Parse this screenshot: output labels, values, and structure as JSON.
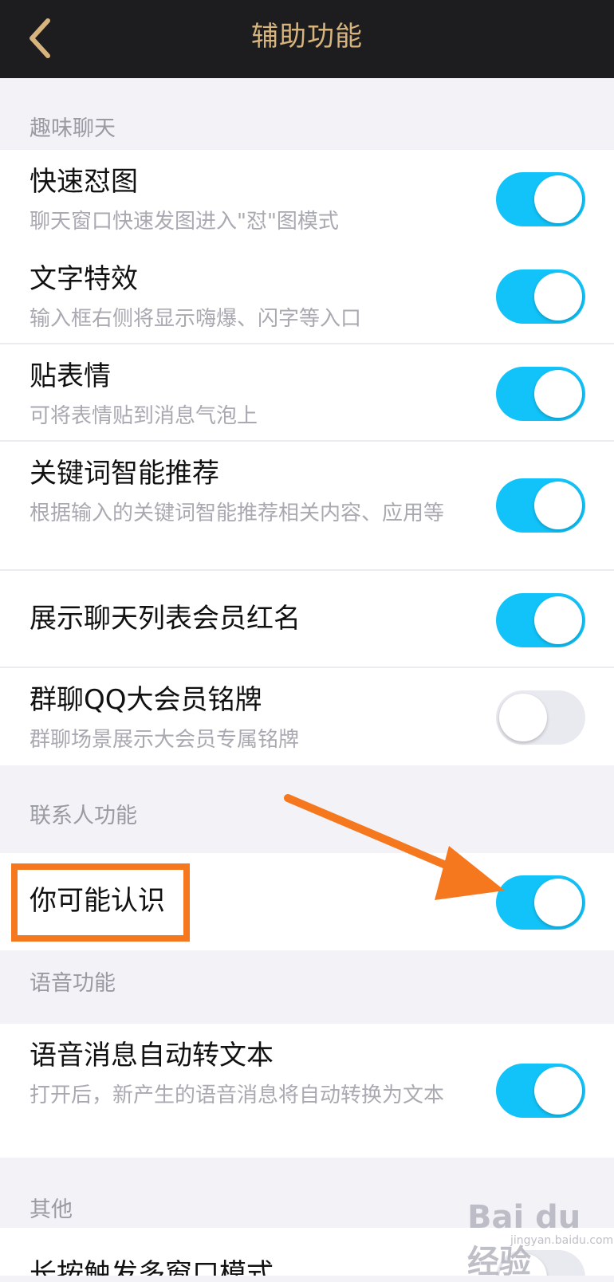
{
  "nav": {
    "title": "辅助功能",
    "back_icon": "chevron-left-icon"
  },
  "sections": [
    {
      "header": "趣味聊天",
      "rows": [
        {
          "title": "快速怼图",
          "subtitle": "聊天窗口快速发图进入\"怼\"图模式",
          "enabled": true
        },
        {
          "title": "文字特效",
          "subtitle": "输入框右侧将显示嗨爆、闪字等入口",
          "enabled": true
        },
        {
          "title": "贴表情",
          "subtitle": "可将表情贴到消息气泡上",
          "enabled": true
        },
        {
          "title": "关键词智能推荐",
          "subtitle": "根据输入的关键词智能推荐相关内容、应用等",
          "enabled": true
        },
        {
          "title": "展示聊天列表会员红名",
          "subtitle": "",
          "enabled": true
        },
        {
          "title": "群聊QQ大会员铭牌",
          "subtitle": "群聊场景展示大会员专属铭牌",
          "enabled": false
        }
      ]
    },
    {
      "header": "联系人功能",
      "rows": [
        {
          "title": "你可能认识",
          "subtitle": "",
          "enabled": true
        }
      ]
    },
    {
      "header": "语音功能",
      "rows": [
        {
          "title": "语音消息自动转文本",
          "subtitle": "打开后，新产生的语音消息将自动转换为文本",
          "enabled": true
        }
      ]
    },
    {
      "header": "其他",
      "rows": [
        {
          "title": "长按触发多窗口模式",
          "subtitle": "",
          "enabled": false
        }
      ]
    }
  ],
  "annotation": {
    "color": "#f5781e"
  },
  "colors": {
    "toggle_on": "#12c3f9",
    "toggle_off": "#e9e9f0",
    "nav_bg": "#1d1d1f",
    "nav_title": "#d7b37e"
  },
  "watermark": {
    "logo": "Bai du 经验",
    "url": "jingyan.baidu.com"
  }
}
